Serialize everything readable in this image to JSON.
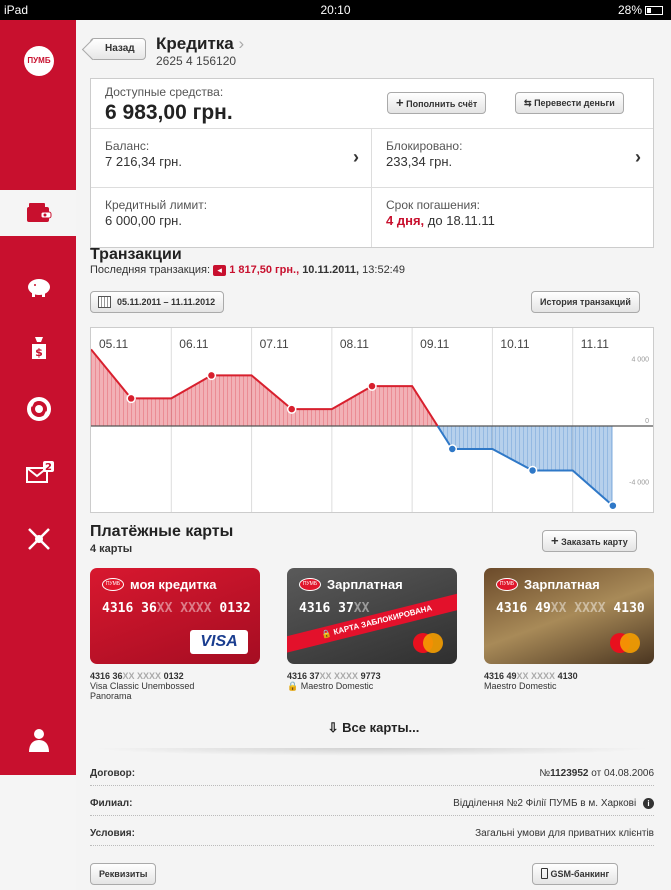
{
  "status_bar": {
    "device": "iPad",
    "time": "20:10",
    "battery": "28%"
  },
  "sidebar": {
    "logo": "ПУМБ",
    "items": [
      {
        "name": "wallet",
        "active": true
      },
      {
        "name": "piggy-bank"
      },
      {
        "name": "money-bag"
      },
      {
        "name": "exchange"
      },
      {
        "name": "messages",
        "badge": "2"
      },
      {
        "name": "satellite"
      },
      {
        "name": "profile"
      }
    ]
  },
  "header": {
    "back_label": "Назад",
    "title": "Кредитка",
    "account_number": "2625 4 156120"
  },
  "account": {
    "available_label": "Доступные средства:",
    "available_value": "6 983,00 грн.",
    "topup_label": "Пополнить счёт",
    "transfer_label": "Перевести деньги",
    "balance_label": "Баланс:",
    "balance_value": "7 216,34 грн.",
    "blocked_label": "Блокировано:",
    "blocked_value": "233,34 грн.",
    "limit_label": "Кредитный лимит:",
    "limit_value": "6 000,00 грн.",
    "due_label": "Срок погашения:",
    "due_days": "4 дня,",
    "due_date": "до 18.11.11"
  },
  "transactions": {
    "title": "Транзакции",
    "last_label": "Последняя транзакция:",
    "last_amount": "1 817,50 грн.,",
    "last_date": "10.11.2011,",
    "last_time": "13:52:49",
    "range": "05.11.2011 – 11.11.2012",
    "history_label": "История транзакций"
  },
  "chart_data": {
    "type": "area",
    "categories": [
      "05.11",
      "06.11",
      "07.11",
      "08.11",
      "09.11",
      "10.11",
      "11.11"
    ],
    "y_ticks": [
      "4 000",
      "0",
      "-4 000"
    ],
    "ylim": [
      -6000,
      6000
    ],
    "x": [
      0,
      0.5,
      1,
      1.5,
      2,
      2.5,
      3,
      3.5,
      3.75,
      4,
      4.5,
      5,
      5.5,
      6,
      6.5
    ],
    "y": [
      5000,
      1800,
      1800,
      3300,
      3300,
      1100,
      1100,
      2600,
      2600,
      2600,
      -1500,
      -1500,
      -2900,
      -2900,
      -5200
    ],
    "markers_x": [
      0.5,
      1.5,
      2.5,
      3.5,
      4.5,
      5.5,
      6.5
    ],
    "positive_color": "#d8202e",
    "negative_color": "#2f78c7",
    "xlabel": "",
    "ylabel": ""
  },
  "cards": {
    "title": "Платёжные карты",
    "count": "4 карты",
    "order_label": "Заказать карту",
    "all_label": "Все карты...",
    "items": [
      {
        "name": "моя кредитка",
        "number_a": "4316 36",
        "number_mask": "XX XXXX",
        "number_b": "0132",
        "face_a": "4316 36",
        "face_b": "0132",
        "face_mask": "XX XXXX",
        "brand": "VISA",
        "caption_line1": "Visa Classic Unembossed",
        "caption_line2": "Panorama",
        "bg": "#c8102e",
        "locked": false
      },
      {
        "name": "Зарплатная",
        "number_a": "4316 37",
        "number_mask": "XX XXXX",
        "number_b": "9773",
        "face_a": "4316 37",
        "face_b": "",
        "face_mask": "XX",
        "brand": "MasterCard",
        "caption_line1": "Maestro Domestic",
        "caption_line2": "",
        "bg": "#4a4a4a",
        "locked": true,
        "locked_label": "КАРТА ЗАБЛОКИРОВАНА"
      },
      {
        "name": "Зарплатная",
        "number_a": "4316 49",
        "number_mask": "XX XXXX",
        "number_b": "4130",
        "face_a": "4316 49",
        "face_b": "4130",
        "face_mask": "XX XXXX",
        "brand": "MasterCard",
        "caption_line1": "Maestro Domestic",
        "caption_line2": "",
        "bg": "#8a6a3a",
        "locked": false
      }
    ]
  },
  "details": [
    {
      "key": "Договор:",
      "value_prefix": "№",
      "value_bold": "1123952",
      "value": "от 04.08.2006"
    },
    {
      "key": "Филиал:",
      "value": "Відділення №2 Філії ПУМБ в м. Харкові"
    },
    {
      "key": "Условия:",
      "value": "Загальні умови для приватних клієнтів"
    }
  ],
  "footer": {
    "requisites_label": "Реквизиты",
    "gsm_label": "GSM-банкинг"
  }
}
